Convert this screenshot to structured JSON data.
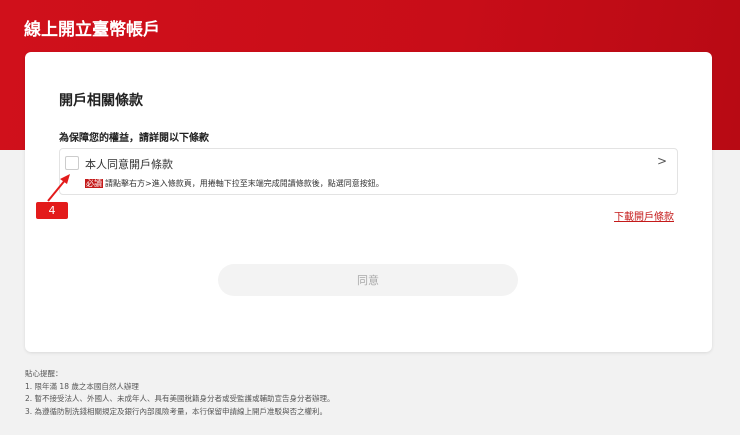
{
  "header": {
    "title": "線上開立臺幣帳戶"
  },
  "card": {
    "heading": "開戶相關條款",
    "subheading": "為保障您的權益，請詳閱以下條款",
    "term": {
      "label": "本人同意開戶條款",
      "required_tag": "必讀",
      "note": "請點擊右方>進入條款頁，用捲軸下拉至末端完成閱讀條款後，點選同意按鈕。",
      "checked": false
    },
    "download_link": "下載開戶條款",
    "agree_button": "同意"
  },
  "annotation": {
    "step": "4"
  },
  "tips": {
    "title": "貼心提醒：",
    "items": [
      "1. 限年滿 18 歲之本國自然人辦理",
      "2. 暫不接受法人、外國人、未成年人、具有美國稅籍身分者或受監護或輔助宣告身分者辦理。",
      "3. 為遵循防制洗錢相關規定及銀行內部風險考量，本行保留申請線上開戶准駁與否之權利。"
    ]
  }
}
